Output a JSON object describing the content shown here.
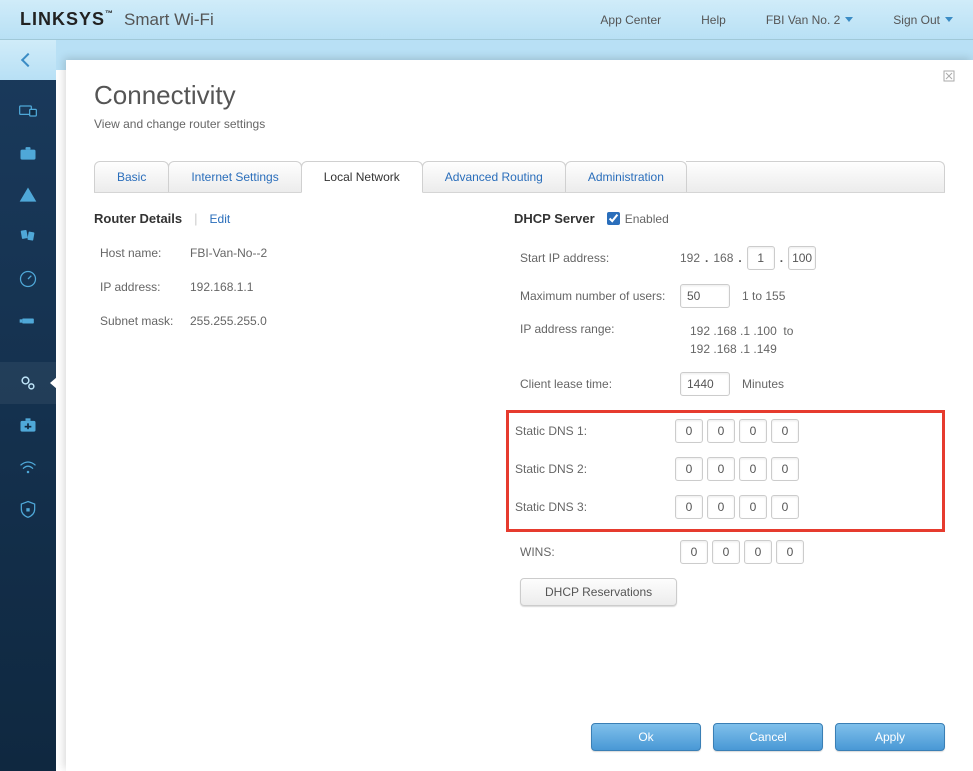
{
  "header": {
    "brand": "LINKSYS",
    "subbrand": "Smart Wi-Fi",
    "nav": {
      "app_center": "App Center",
      "help": "Help",
      "network_name": "FBI Van No. 2",
      "sign_out": "Sign Out"
    }
  },
  "page": {
    "title": "Connectivity",
    "subtitle": "View and change router settings"
  },
  "tabs": {
    "basic": "Basic",
    "internet": "Internet Settings",
    "local": "Local Network",
    "advanced": "Advanced Routing",
    "admin": "Administration"
  },
  "router_details": {
    "heading": "Router Details",
    "edit": "Edit",
    "host_label": "Host name:",
    "host_value": "FBI-Van-No--2",
    "ip_label": "IP address:",
    "ip_value": "192.168.1.1",
    "mask_label": "Subnet mask:",
    "mask_value": "255.255.255.0"
  },
  "dhcp": {
    "heading": "DHCP Server",
    "enabled_label": "Enabled",
    "enabled": true,
    "start_ip_label": "Start IP address:",
    "start_ip": {
      "a": "192",
      "b": "168",
      "c": "1",
      "d": "100"
    },
    "max_users_label": "Maximum number of users:",
    "max_users": "50",
    "max_users_hint": "1 to 155",
    "range_label": "IP address range:",
    "range_from": "192 .168 .1 .100",
    "range_to_word": "to",
    "range_to": "192 .168 .1 .149",
    "lease_label": "Client lease time:",
    "lease_value": "1440",
    "lease_unit": "Minutes",
    "dns1_label": "Static DNS 1:",
    "dns1": {
      "a": "0",
      "b": "0",
      "c": "0",
      "d": "0"
    },
    "dns2_label": "Static DNS 2:",
    "dns2": {
      "a": "0",
      "b": "0",
      "c": "0",
      "d": "0"
    },
    "dns3_label": "Static DNS 3:",
    "dns3": {
      "a": "0",
      "b": "0",
      "c": "0",
      "d": "0"
    },
    "wins_label": "WINS:",
    "wins": {
      "a": "0",
      "b": "0",
      "c": "0",
      "d": "0"
    },
    "reservations_btn": "DHCP Reservations"
  },
  "footer": {
    "ok": "Ok",
    "cancel": "Cancel",
    "apply": "Apply"
  }
}
